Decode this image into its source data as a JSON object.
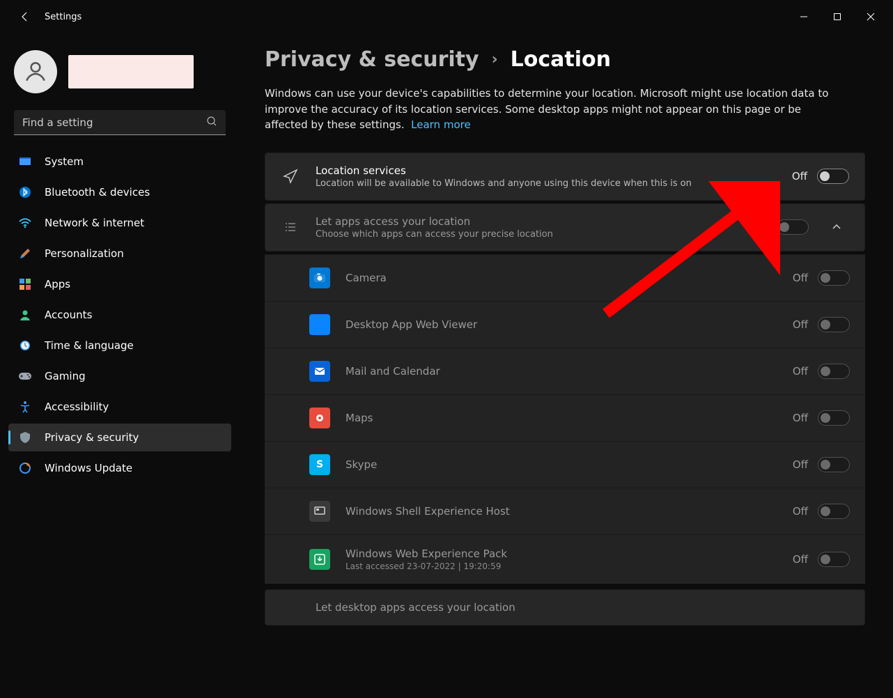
{
  "window": {
    "title": "Settings"
  },
  "search": {
    "placeholder": "Find a setting"
  },
  "nav": [
    {
      "id": "system",
      "label": "System"
    },
    {
      "id": "bluetooth",
      "label": "Bluetooth & devices"
    },
    {
      "id": "network",
      "label": "Network & internet"
    },
    {
      "id": "personalization",
      "label": "Personalization"
    },
    {
      "id": "apps",
      "label": "Apps"
    },
    {
      "id": "accounts",
      "label": "Accounts"
    },
    {
      "id": "time",
      "label": "Time & language"
    },
    {
      "id": "gaming",
      "label": "Gaming"
    },
    {
      "id": "accessibility",
      "label": "Accessibility"
    },
    {
      "id": "privacy",
      "label": "Privacy & security",
      "active": true
    },
    {
      "id": "update",
      "label": "Windows Update"
    }
  ],
  "breadcrumb": {
    "parent": "Privacy & security",
    "current": "Location"
  },
  "description": "Windows can use your device's capabilities to determine your location. Microsoft might use location data to improve the accuracy of its location services. Some desktop apps might not appear on this page or be affected by these settings.",
  "learn_more": "Learn more",
  "location_services": {
    "title": "Location services",
    "sub": "Location will be available to Windows and anyone using this device when this is on",
    "state": "Off"
  },
  "apps_access": {
    "title": "Let apps access your location",
    "sub": "Choose which apps can access your precise location",
    "state": "Off"
  },
  "app_list": [
    {
      "id": "camera",
      "name": "Camera",
      "state": "Off",
      "color": "#0078d4"
    },
    {
      "id": "dawv",
      "name": "Desktop App Web Viewer",
      "state": "Off",
      "color": "#0a84ff"
    },
    {
      "id": "mail",
      "name": "Mail and Calendar",
      "state": "Off",
      "color": "#0a63d6"
    },
    {
      "id": "maps",
      "name": "Maps",
      "state": "Off",
      "color": "#e74c3c"
    },
    {
      "id": "skype",
      "name": "Skype",
      "state": "Off",
      "color": "#00aff0"
    },
    {
      "id": "shell",
      "name": "Windows Shell Experience Host",
      "state": "Off",
      "color": "#3a3a3a"
    },
    {
      "id": "webexp",
      "name": "Windows Web Experience Pack",
      "state": "Off",
      "color": "#1aa260",
      "sub": "Last accessed 23-07-2022  |  19:20:59"
    }
  ],
  "desktop_apps": {
    "title": "Let desktop apps access your location"
  }
}
